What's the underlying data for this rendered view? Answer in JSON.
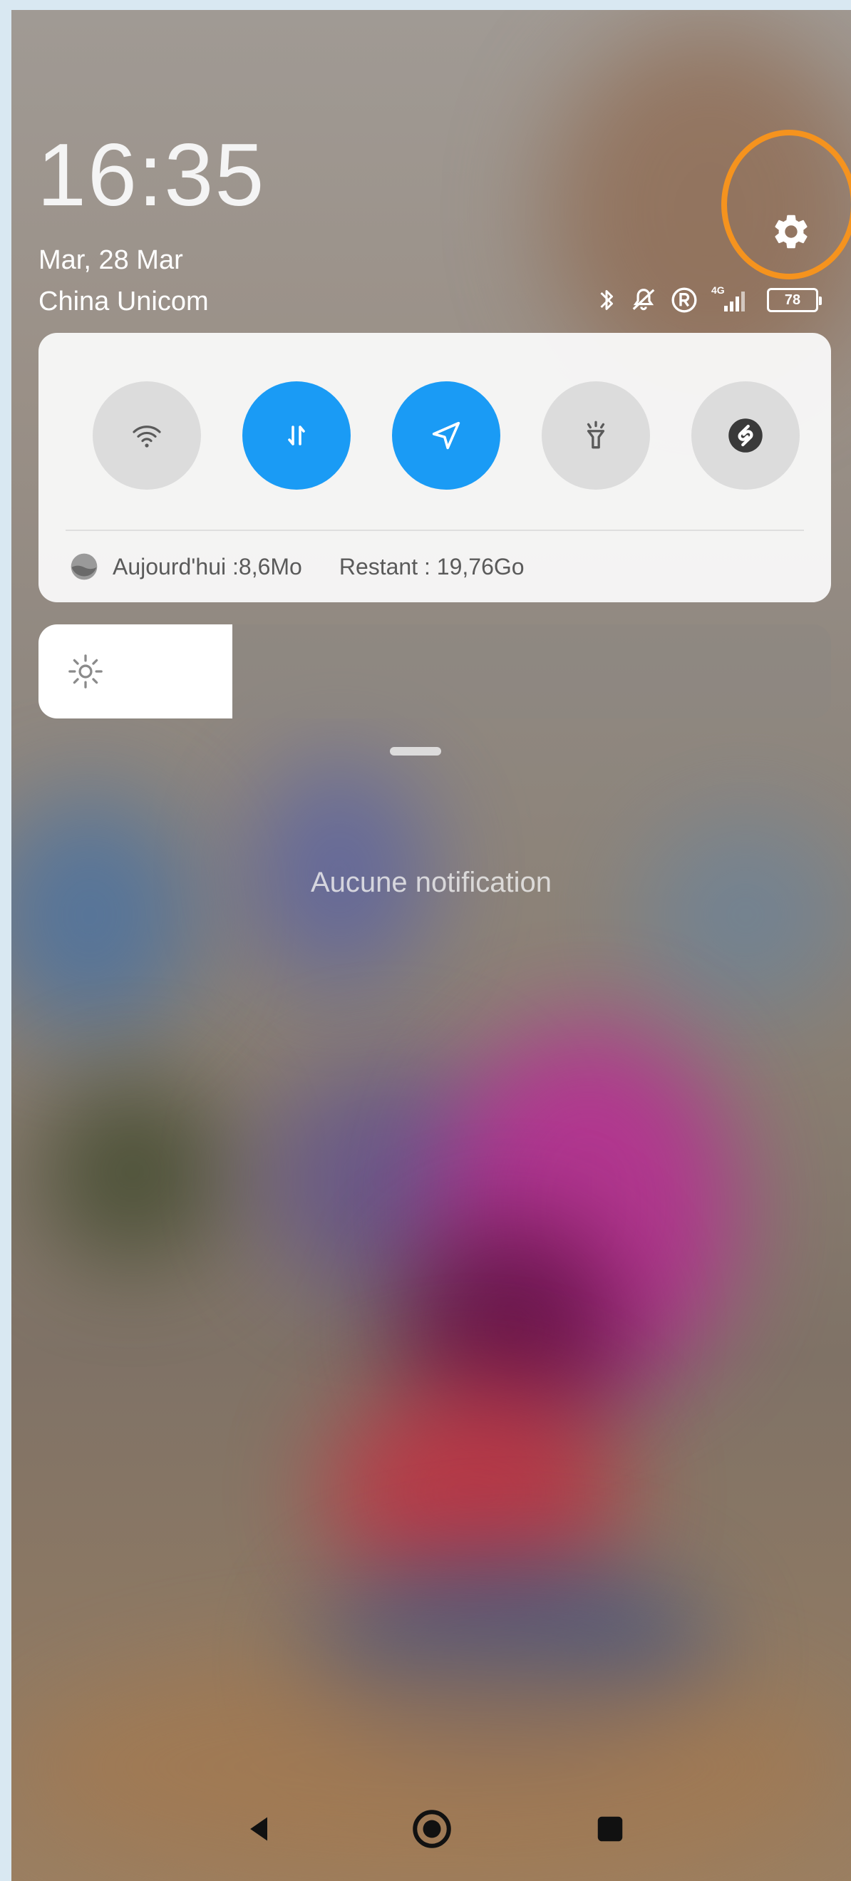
{
  "status": {
    "time": "16:35",
    "date": "Mar, 28 Mar",
    "carrier": "China Unicom",
    "network_type": "4G",
    "battery_level": "78",
    "icons": [
      "bluetooth-icon",
      "notifications-off-icon",
      "registered-icon",
      "signal-icon",
      "battery-icon"
    ]
  },
  "quick_toggles": [
    {
      "name": "wifi",
      "icon": "wifi-icon",
      "state": "off"
    },
    {
      "name": "mobile-data",
      "icon": "data-transfer-icon",
      "state": "on"
    },
    {
      "name": "location",
      "icon": "location-arrow-icon",
      "state": "on"
    },
    {
      "name": "flashlight",
      "icon": "flashlight-icon",
      "state": "off"
    },
    {
      "name": "shazam",
      "icon": "shazam-icon",
      "state": "off"
    }
  ],
  "data_usage": {
    "today": "Aujourd'hui :8,6Mo",
    "remaining": "Restant : 19,76Go"
  },
  "brightness": {
    "level": 0.245
  },
  "notifications": {
    "empty_text": "Aucune notification"
  },
  "colors": {
    "accent": "#1a9bf5",
    "highlight": "#f5931e",
    "toggle_off": "#dcdcdc"
  }
}
